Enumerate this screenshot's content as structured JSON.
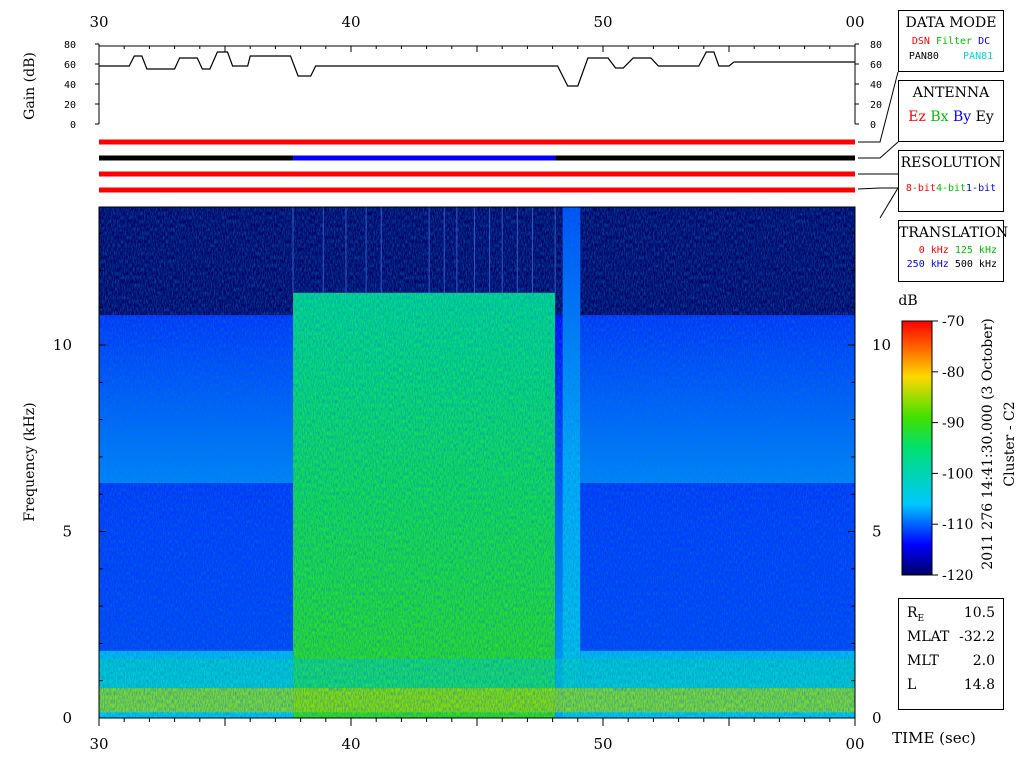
{
  "chart_data": {
    "type": "heatmap",
    "time_axis": {
      "label": "TIME (sec)",
      "ticks": [
        "30",
        "40",
        "50",
        "00"
      ],
      "range": [
        30,
        60
      ]
    },
    "gain_panel": {
      "ylabel": "Gain (dB)",
      "yticks": [
        "80",
        "60",
        "40",
        "20",
        "0"
      ],
      "ylim": [
        0,
        80
      ],
      "trace": [
        [
          30,
          58
        ],
        [
          31.2,
          58
        ],
        [
          31.4,
          68
        ],
        [
          31.7,
          68
        ],
        [
          31.9,
          55
        ],
        [
          33.0,
          55
        ],
        [
          33.2,
          66
        ],
        [
          33.9,
          66
        ],
        [
          34.1,
          55
        ],
        [
          34.4,
          55
        ],
        [
          34.7,
          72
        ],
        [
          35.1,
          72
        ],
        [
          35.3,
          58
        ],
        [
          35.9,
          58
        ],
        [
          36.0,
          68
        ],
        [
          37.6,
          68
        ],
        [
          37.9,
          48
        ],
        [
          38.4,
          48
        ],
        [
          38.6,
          58
        ],
        [
          48.2,
          58
        ],
        [
          48.6,
          38
        ],
        [
          49.0,
          38
        ],
        [
          49.4,
          66
        ],
        [
          50.2,
          66
        ],
        [
          50.5,
          56
        ],
        [
          50.8,
          56
        ],
        [
          51.2,
          66
        ],
        [
          51.9,
          66
        ],
        [
          52.2,
          58
        ],
        [
          53.8,
          58
        ],
        [
          54.1,
          72
        ],
        [
          54.4,
          72
        ],
        [
          54.6,
          58
        ],
        [
          55.0,
          58
        ],
        [
          55.2,
          62
        ],
        [
          60,
          62
        ]
      ]
    },
    "mode_bars": [
      {
        "segments": [
          [
            30,
            60,
            "#ff0000"
          ]
        ]
      },
      {
        "segments": [
          [
            30,
            37.7,
            "#000000"
          ],
          [
            37.7,
            48.1,
            "#0000ff"
          ],
          [
            48.1,
            60,
            "#000000"
          ]
        ]
      },
      {
        "segments": [
          [
            30,
            60,
            "#ff0000"
          ]
        ]
      },
      {
        "segments": [
          [
            30,
            60,
            "#ff0000"
          ]
        ]
      }
    ],
    "spectrogram": {
      "ylabel": "Frequency (kHz)",
      "yticks": [
        "0",
        "5",
        "10"
      ],
      "ylim": [
        0,
        13.7
      ],
      "regions": [
        {
          "t0": 30,
          "t1": 37.7,
          "fmax": 10.8,
          "level": -108,
          "lower_dark_below": 6.3,
          "lower_level": -113
        },
        {
          "t0": 37.7,
          "t1": 48.1,
          "fmax": 11.4,
          "level": -93
        },
        {
          "t0": 48.1,
          "t1": 49.0,
          "fmax": 10.8,
          "level": -110
        },
        {
          "t0": 48.4,
          "t1": 49.1,
          "fmax": 13.7,
          "level": -107
        },
        {
          "t0": 49.1,
          "t1": 60,
          "fmax": 10.8,
          "level": -108,
          "lower_dark_below": 6.3,
          "lower_level": -113
        }
      ],
      "low_band_level": -85,
      "background_level": -120
    },
    "colorbar": {
      "label": "dB",
      "ticks": [
        "-70",
        "-80",
        "-90",
        "-100",
        "-110",
        "-120"
      ],
      "range": [
        -120,
        -70
      ]
    },
    "side_label": "2011 276 14:41:30.000 (3 October)",
    "spacecraft": "Cluster - C2"
  },
  "legend": {
    "data_mode": {
      "title": "DATA MODE",
      "items": [
        {
          "label": "DSN",
          "color": "#ff0000"
        },
        {
          "label": "Filter",
          "color": "#00c000"
        },
        {
          "label": "DC",
          "color": "#0000ff"
        },
        {
          "label": "PAN80",
          "color": "#000000"
        },
        {
          "label": "PAN81",
          "color": "#00d8d8"
        }
      ]
    },
    "antenna": {
      "title": "ANTENNA",
      "items": [
        {
          "label": "Ez",
          "color": "#ff0000"
        },
        {
          "label": "Bx",
          "color": "#00c000"
        },
        {
          "label": "By",
          "color": "#0000ff"
        },
        {
          "label": "Ey",
          "color": "#000000"
        }
      ]
    },
    "resolution": {
      "title": "RESOLUTION",
      "items": [
        {
          "label": "8-bit",
          "color": "#ff0000"
        },
        {
          "label": "4-bit",
          "color": "#00c000"
        },
        {
          "label": "1-bit",
          "color": "#0000ff"
        }
      ]
    },
    "translation": {
      "title": "TRANSLATION",
      "items": [
        {
          "label": "0 kHz",
          "color": "#ff0000"
        },
        {
          "label": "125 kHz",
          "color": "#00c000"
        },
        {
          "label": "250 kHz",
          "color": "#0000ff"
        },
        {
          "label": "500 kHz",
          "color": "#000000"
        }
      ]
    }
  },
  "orbit_info": [
    {
      "label": "R",
      "sub": "E",
      "value": "10.5"
    },
    {
      "label": "MLAT",
      "value": "-32.2"
    },
    {
      "label": "MLT",
      "value": "2.0"
    },
    {
      "label": "L",
      "value": "14.8"
    }
  ]
}
